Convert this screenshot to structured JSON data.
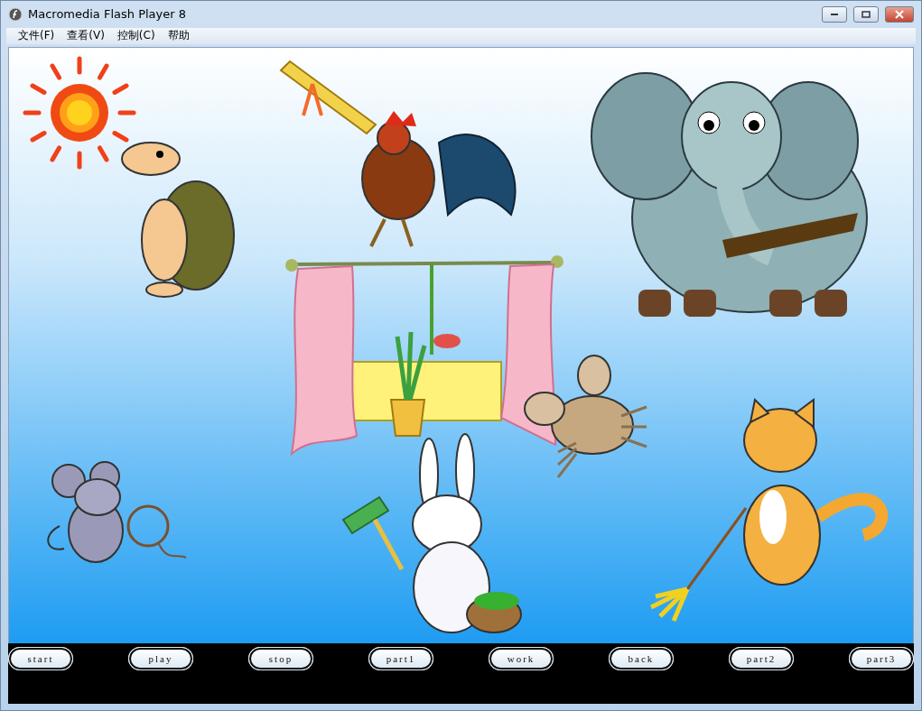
{
  "window": {
    "title": "Macromedia Flash Player 8"
  },
  "menu": [
    {
      "label": "文件(F)"
    },
    {
      "label": "查看(V)"
    },
    {
      "label": "控制(C)"
    },
    {
      "label": "帮助"
    }
  ],
  "buttons": [
    {
      "label": "start"
    },
    {
      "label": "play"
    },
    {
      "label": "stop"
    },
    {
      "label": "part1"
    },
    {
      "label": "work"
    },
    {
      "label": "back"
    },
    {
      "label": "part2"
    },
    {
      "label": "part3"
    }
  ]
}
